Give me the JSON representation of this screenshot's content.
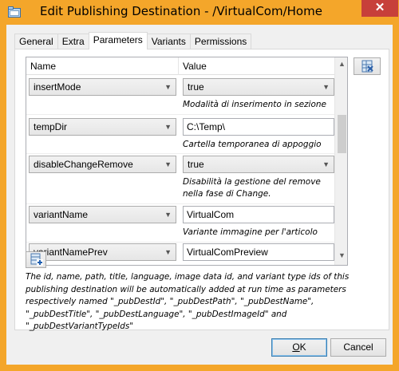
{
  "window": {
    "title": "Edit Publishing Destination - /VirtualCom/Home",
    "close_glyph": "✕"
  },
  "tabs": [
    {
      "label": "General"
    },
    {
      "label": "Extra"
    },
    {
      "label": "Parameters",
      "active": true
    },
    {
      "label": "Variants"
    },
    {
      "label": "Permissions"
    }
  ],
  "grid": {
    "columns": {
      "name": "Name",
      "value": "Value"
    },
    "rows": [
      {
        "name": "insertMode",
        "value": "true",
        "value_type": "combo",
        "description": "Modalità di inserimento in sezione"
      },
      {
        "name": "tempDir",
        "value": "C:\\Temp\\",
        "value_type": "text",
        "description": "Cartella temporanea di appoggio"
      },
      {
        "name": "disableChangeRemove",
        "value": "true",
        "value_type": "combo",
        "description": "Disabilità la gestione del remove nella fase di Change."
      },
      {
        "name": "variantName",
        "value": "VirtualCom",
        "value_type": "text",
        "description": "Variante immagine per l'articolo"
      },
      {
        "name": "variantNamePrev",
        "value": "VirtualComPreview",
        "value_type": "text",
        "description": ""
      }
    ]
  },
  "notes": "The id, name, path, title, language, image data id, and variant type ids of this publishing destination will be automatically added at run time as parameters respectively named \"_pubDestId\", \"_pubDestPath\", \"_pubDestName\", \"_pubDestTitle\", \"_pubDestLanguage\", \"_pubDestImageId\" and \"_pubDestVariantTypeIds\"",
  "buttons": {
    "ok": {
      "mnemonic": "O",
      "rest": "K"
    },
    "cancel": "Cancel"
  },
  "colors": {
    "title_bar": "#f4a62a",
    "close_button": "#c7403a"
  },
  "icons": {
    "app": "folder-icon",
    "clear": "clear-grid-icon",
    "add": "add-row-icon"
  }
}
